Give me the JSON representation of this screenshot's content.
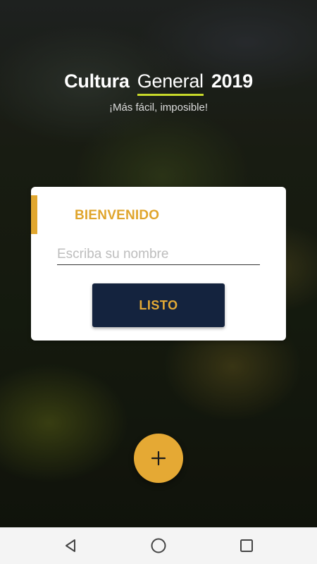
{
  "app": {
    "title_part1": "Cultura",
    "title_part2": "General",
    "title_part3": "2019",
    "subtitle": "¡Más fácil, imposible!"
  },
  "card": {
    "heading": "BIENVENIDO",
    "name_input_placeholder": "Escriba su nombre",
    "name_input_value": "",
    "submit_label": "LISTO"
  },
  "fab": {
    "icon": "plus-icon"
  },
  "navbar": {
    "back_icon": "back-triangle-icon",
    "home_icon": "home-circle-icon",
    "recents_icon": "recents-square-icon"
  },
  "colors": {
    "accent": "#e1a72f",
    "button_bg": "#14233e",
    "title_underline": "#c8d92a"
  }
}
